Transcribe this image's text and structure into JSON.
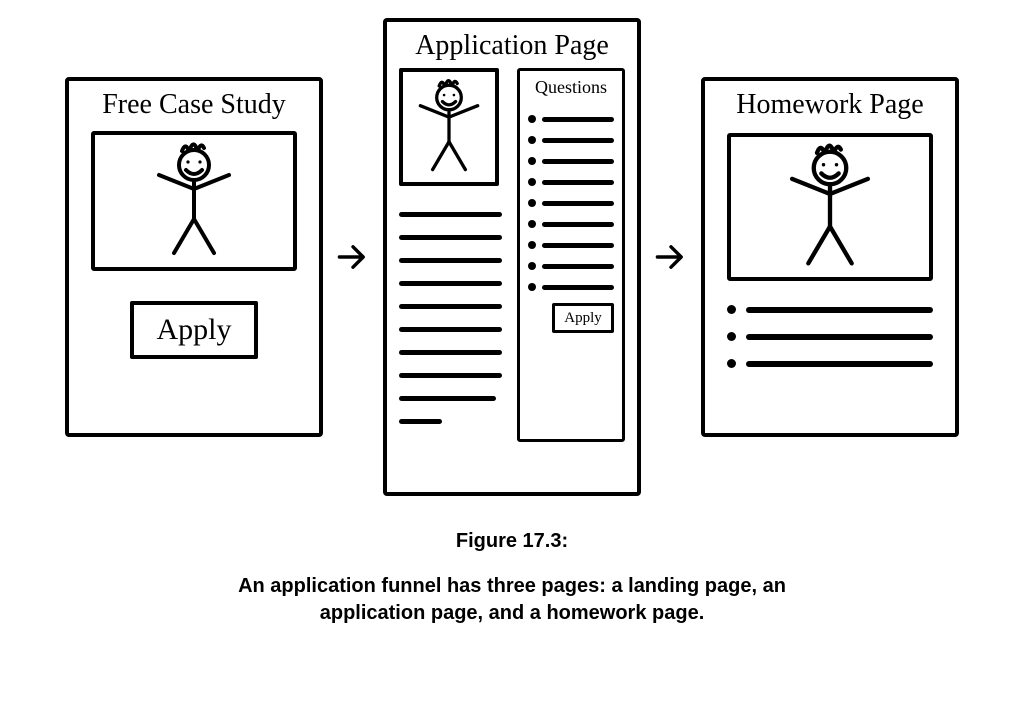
{
  "panels": {
    "case_study": {
      "title": "Free Case Study",
      "button": "Apply"
    },
    "application": {
      "title": "Application Page",
      "questions_heading": "Questions",
      "question_count": 9,
      "left_text_lines": 10,
      "button": "Apply"
    },
    "homework": {
      "title": "Homework Page",
      "bullet_count": 3
    }
  },
  "caption": {
    "figure_label": "Figure 17.3:",
    "text": "An application funnel has three pages: a landing page, an application page, and a homework page."
  },
  "icons": {
    "arrow": "arrow-right",
    "person": "stick-figure"
  }
}
